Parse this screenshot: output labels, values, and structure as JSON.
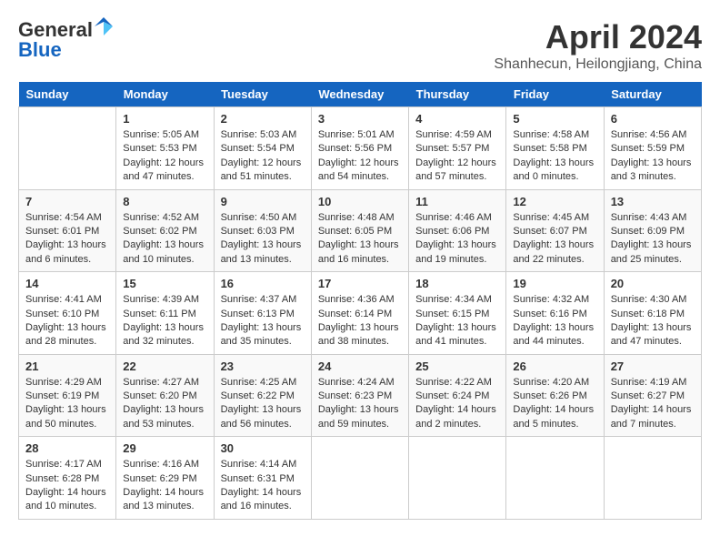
{
  "header": {
    "logo_line1": "General",
    "logo_line2": "Blue",
    "month": "April 2024",
    "location": "Shanhecun, Heilongjiang, China"
  },
  "calendar": {
    "weekdays": [
      "Sunday",
      "Monday",
      "Tuesday",
      "Wednesday",
      "Thursday",
      "Friday",
      "Saturday"
    ],
    "weeks": [
      [
        {
          "day": "",
          "sunrise": "",
          "sunset": "",
          "daylight": ""
        },
        {
          "day": "1",
          "sunrise": "Sunrise: 5:05 AM",
          "sunset": "Sunset: 5:53 PM",
          "daylight": "Daylight: 12 hours and 47 minutes."
        },
        {
          "day": "2",
          "sunrise": "Sunrise: 5:03 AM",
          "sunset": "Sunset: 5:54 PM",
          "daylight": "Daylight: 12 hours and 51 minutes."
        },
        {
          "day": "3",
          "sunrise": "Sunrise: 5:01 AM",
          "sunset": "Sunset: 5:56 PM",
          "daylight": "Daylight: 12 hours and 54 minutes."
        },
        {
          "day": "4",
          "sunrise": "Sunrise: 4:59 AM",
          "sunset": "Sunset: 5:57 PM",
          "daylight": "Daylight: 12 hours and 57 minutes."
        },
        {
          "day": "5",
          "sunrise": "Sunrise: 4:58 AM",
          "sunset": "Sunset: 5:58 PM",
          "daylight": "Daylight: 13 hours and 0 minutes."
        },
        {
          "day": "6",
          "sunrise": "Sunrise: 4:56 AM",
          "sunset": "Sunset: 5:59 PM",
          "daylight": "Daylight: 13 hours and 3 minutes."
        }
      ],
      [
        {
          "day": "7",
          "sunrise": "Sunrise: 4:54 AM",
          "sunset": "Sunset: 6:01 PM",
          "daylight": "Daylight: 13 hours and 6 minutes."
        },
        {
          "day": "8",
          "sunrise": "Sunrise: 4:52 AM",
          "sunset": "Sunset: 6:02 PM",
          "daylight": "Daylight: 13 hours and 10 minutes."
        },
        {
          "day": "9",
          "sunrise": "Sunrise: 4:50 AM",
          "sunset": "Sunset: 6:03 PM",
          "daylight": "Daylight: 13 hours and 13 minutes."
        },
        {
          "day": "10",
          "sunrise": "Sunrise: 4:48 AM",
          "sunset": "Sunset: 6:05 PM",
          "daylight": "Daylight: 13 hours and 16 minutes."
        },
        {
          "day": "11",
          "sunrise": "Sunrise: 4:46 AM",
          "sunset": "Sunset: 6:06 PM",
          "daylight": "Daylight: 13 hours and 19 minutes."
        },
        {
          "day": "12",
          "sunrise": "Sunrise: 4:45 AM",
          "sunset": "Sunset: 6:07 PM",
          "daylight": "Daylight: 13 hours and 22 minutes."
        },
        {
          "day": "13",
          "sunrise": "Sunrise: 4:43 AM",
          "sunset": "Sunset: 6:09 PM",
          "daylight": "Daylight: 13 hours and 25 minutes."
        }
      ],
      [
        {
          "day": "14",
          "sunrise": "Sunrise: 4:41 AM",
          "sunset": "Sunset: 6:10 PM",
          "daylight": "Daylight: 13 hours and 28 minutes."
        },
        {
          "day": "15",
          "sunrise": "Sunrise: 4:39 AM",
          "sunset": "Sunset: 6:11 PM",
          "daylight": "Daylight: 13 hours and 32 minutes."
        },
        {
          "day": "16",
          "sunrise": "Sunrise: 4:37 AM",
          "sunset": "Sunset: 6:13 PM",
          "daylight": "Daylight: 13 hours and 35 minutes."
        },
        {
          "day": "17",
          "sunrise": "Sunrise: 4:36 AM",
          "sunset": "Sunset: 6:14 PM",
          "daylight": "Daylight: 13 hours and 38 minutes."
        },
        {
          "day": "18",
          "sunrise": "Sunrise: 4:34 AM",
          "sunset": "Sunset: 6:15 PM",
          "daylight": "Daylight: 13 hours and 41 minutes."
        },
        {
          "day": "19",
          "sunrise": "Sunrise: 4:32 AM",
          "sunset": "Sunset: 6:16 PM",
          "daylight": "Daylight: 13 hours and 44 minutes."
        },
        {
          "day": "20",
          "sunrise": "Sunrise: 4:30 AM",
          "sunset": "Sunset: 6:18 PM",
          "daylight": "Daylight: 13 hours and 47 minutes."
        }
      ],
      [
        {
          "day": "21",
          "sunrise": "Sunrise: 4:29 AM",
          "sunset": "Sunset: 6:19 PM",
          "daylight": "Daylight: 13 hours and 50 minutes."
        },
        {
          "day": "22",
          "sunrise": "Sunrise: 4:27 AM",
          "sunset": "Sunset: 6:20 PM",
          "daylight": "Daylight: 13 hours and 53 minutes."
        },
        {
          "day": "23",
          "sunrise": "Sunrise: 4:25 AM",
          "sunset": "Sunset: 6:22 PM",
          "daylight": "Daylight: 13 hours and 56 minutes."
        },
        {
          "day": "24",
          "sunrise": "Sunrise: 4:24 AM",
          "sunset": "Sunset: 6:23 PM",
          "daylight": "Daylight: 13 hours and 59 minutes."
        },
        {
          "day": "25",
          "sunrise": "Sunrise: 4:22 AM",
          "sunset": "Sunset: 6:24 PM",
          "daylight": "Daylight: 14 hours and 2 minutes."
        },
        {
          "day": "26",
          "sunrise": "Sunrise: 4:20 AM",
          "sunset": "Sunset: 6:26 PM",
          "daylight": "Daylight: 14 hours and 5 minutes."
        },
        {
          "day": "27",
          "sunrise": "Sunrise: 4:19 AM",
          "sunset": "Sunset: 6:27 PM",
          "daylight": "Daylight: 14 hours and 7 minutes."
        }
      ],
      [
        {
          "day": "28",
          "sunrise": "Sunrise: 4:17 AM",
          "sunset": "Sunset: 6:28 PM",
          "daylight": "Daylight: 14 hours and 10 minutes."
        },
        {
          "day": "29",
          "sunrise": "Sunrise: 4:16 AM",
          "sunset": "Sunset: 6:29 PM",
          "daylight": "Daylight: 14 hours and 13 minutes."
        },
        {
          "day": "30",
          "sunrise": "Sunrise: 4:14 AM",
          "sunset": "Sunset: 6:31 PM",
          "daylight": "Daylight: 14 hours and 16 minutes."
        },
        {
          "day": "",
          "sunrise": "",
          "sunset": "",
          "daylight": ""
        },
        {
          "day": "",
          "sunrise": "",
          "sunset": "",
          "daylight": ""
        },
        {
          "day": "",
          "sunrise": "",
          "sunset": "",
          "daylight": ""
        },
        {
          "day": "",
          "sunrise": "",
          "sunset": "",
          "daylight": ""
        }
      ]
    ]
  }
}
